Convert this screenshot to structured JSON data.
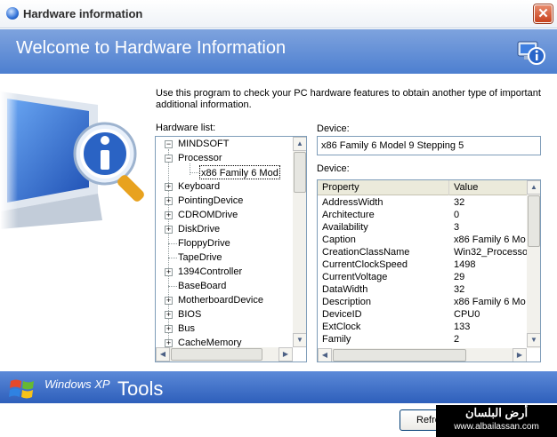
{
  "window": {
    "title": "Hardware information",
    "header_title": "Welcome to Hardware Information"
  },
  "intro": "Use this program to check your PC hardware features to obtain another type of important additional information.",
  "hardware_list": {
    "label": "Hardware list:",
    "root": "MINDSOFT",
    "items": [
      {
        "label": "Processor",
        "level": 1,
        "expander": "-"
      },
      {
        "label": "x86 Family 6 Mod",
        "level": 2,
        "expander": "",
        "selected": true
      },
      {
        "label": "Keyboard",
        "level": 1,
        "expander": "+"
      },
      {
        "label": "PointingDevice",
        "level": 1,
        "expander": "+"
      },
      {
        "label": "CDROMDrive",
        "level": 1,
        "expander": "+"
      },
      {
        "label": "DiskDrive",
        "level": 1,
        "expander": "+"
      },
      {
        "label": "FloppyDrive",
        "level": 1,
        "expander": ""
      },
      {
        "label": "TapeDrive",
        "level": 1,
        "expander": ""
      },
      {
        "label": "1394Controller",
        "level": 1,
        "expander": "+"
      },
      {
        "label": "BaseBoard",
        "level": 1,
        "expander": ""
      },
      {
        "label": "MotherboardDevice",
        "level": 1,
        "expander": "+"
      },
      {
        "label": "BIOS",
        "level": 1,
        "expander": "+"
      },
      {
        "label": "Bus",
        "level": 1,
        "expander": "+"
      },
      {
        "label": "CacheMemory",
        "level": 1,
        "expander": "+"
      }
    ]
  },
  "device": {
    "label": "Device:",
    "value": "x86 Family 6 Model 9 Stepping 5"
  },
  "properties": {
    "label": "Device:",
    "columns": [
      "Property",
      "Value"
    ],
    "rows": [
      [
        "AddressWidth",
        "32"
      ],
      [
        "Architecture",
        "0"
      ],
      [
        "Availability",
        "3"
      ],
      [
        "Caption",
        "x86 Family 6 Mo"
      ],
      [
        "CreationClassName",
        "Win32_Processo"
      ],
      [
        "CurrentClockSpeed",
        "1498"
      ],
      [
        "CurrentVoltage",
        "29"
      ],
      [
        "DataWidth",
        "32"
      ],
      [
        "Description",
        "x86 Family 6 Mo"
      ],
      [
        "DeviceID",
        "CPU0"
      ],
      [
        "ExtClock",
        "133"
      ],
      [
        "Family",
        "2"
      ]
    ]
  },
  "footer": {
    "brand": "Windows XP",
    "tools": "Tools",
    "refresh_button": "Refre"
  },
  "watermark": {
    "arabic": "أرض البلسان",
    "url": "www.albailassan.com"
  },
  "colors": {
    "header": "#5b8ad6",
    "footer": "#3a6ac6",
    "close": "#d6532a"
  }
}
